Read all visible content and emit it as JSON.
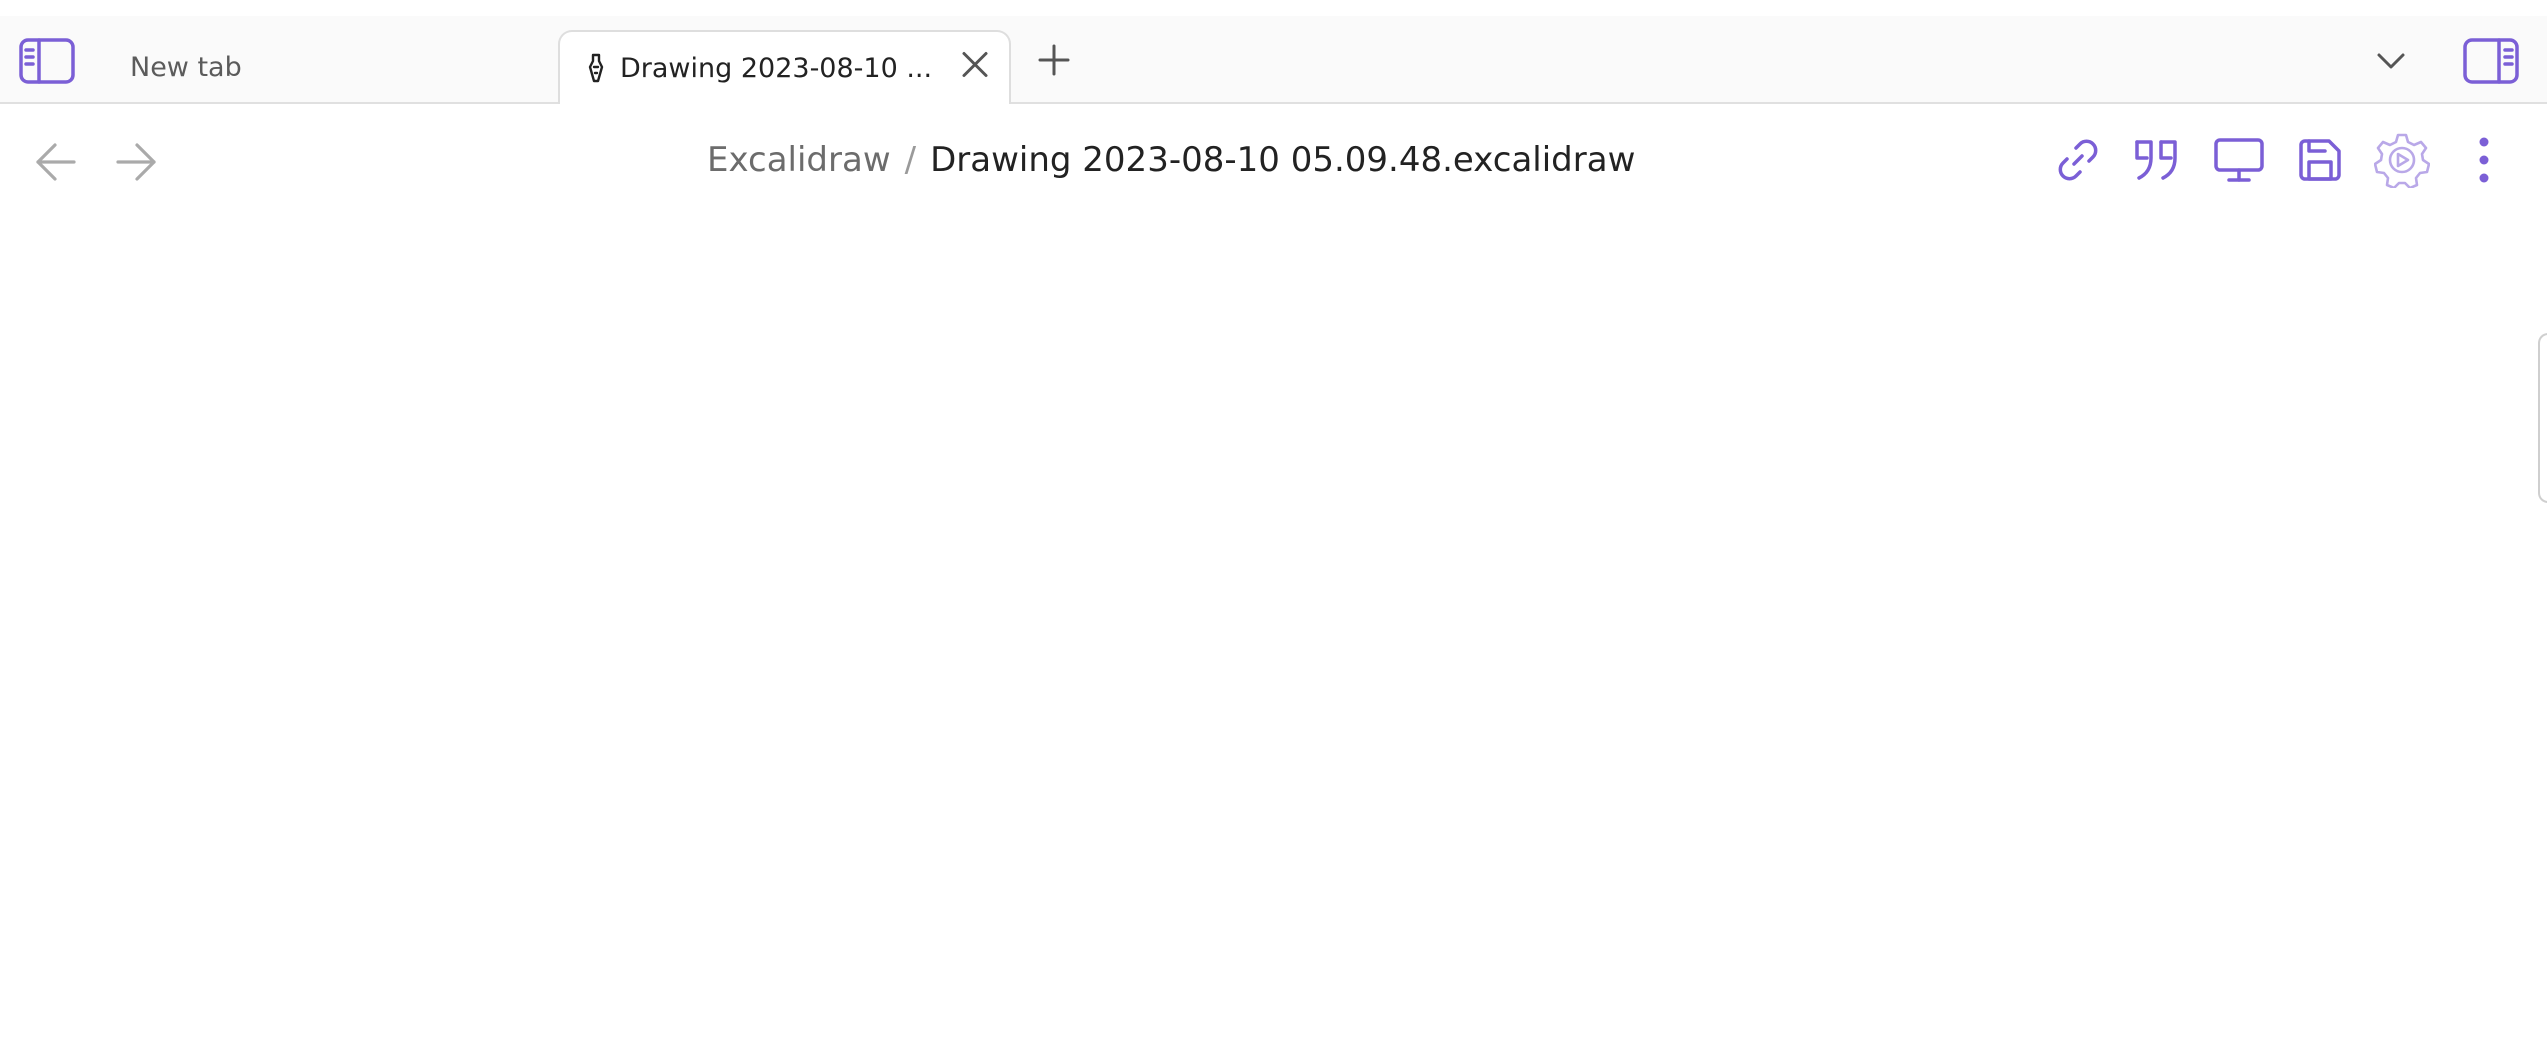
{
  "colors": {
    "accent": "#7b5fd6",
    "tab_strip_bg": "#fafafa",
    "muted_icon": "#aaaaaa",
    "text": "#222222"
  },
  "tabs": [
    {
      "label": "New tab",
      "active": false
    },
    {
      "label": "Drawing 2023-08-10 ...",
      "active": true,
      "icon": "excalidraw-file-icon"
    }
  ],
  "tab_bar": {
    "left_sidebar_toggle_icon": "sidebar-left-icon",
    "new_tab_icon": "plus-icon",
    "tab_list_icon": "chevron-down-icon",
    "right_sidebar_toggle_icon": "sidebar-right-icon",
    "close_icon": "close-icon"
  },
  "navigation": {
    "back_icon": "arrow-left-icon",
    "forward_icon": "arrow-right-icon"
  },
  "breadcrumb": {
    "folder": "Excalidraw",
    "separator": "/",
    "file": "Drawing 2023-08-10 05.09.48.excalidraw"
  },
  "view_actions": [
    {
      "name": "link-icon"
    },
    {
      "name": "quote-icon"
    },
    {
      "name": "monitor-icon"
    },
    {
      "name": "save-icon"
    },
    {
      "name": "script-settings-icon"
    },
    {
      "name": "more-options-icon"
    }
  ]
}
